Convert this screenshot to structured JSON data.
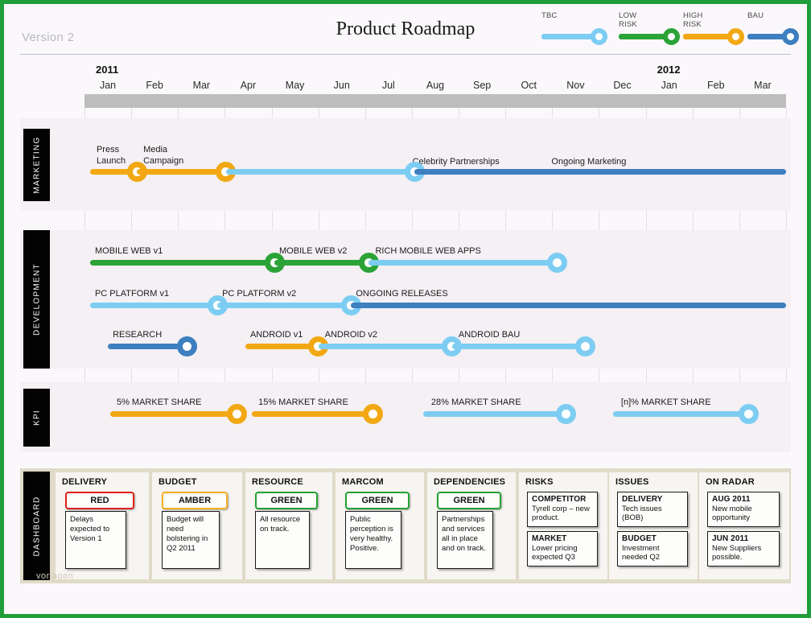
{
  "header": {
    "version": "Version 2",
    "title": "Product Roadmap"
  },
  "colors": {
    "tbc": "#7dcdf3",
    "low_risk": "#2ba337",
    "high_risk": "#f2a813",
    "bau": "#3d7fbf",
    "frame": "#1f9e3a",
    "grey_bar": "#bdbdbd",
    "band": "#f4f0f4",
    "dashboard_bg": "#dfdbc8",
    "red": "#e0201b",
    "amber": "#f2b01e",
    "green": "#23a233"
  },
  "legend": {
    "items": [
      {
        "label": "TBC",
        "color_key": "tbc"
      },
      {
        "label": "LOW\nRISK",
        "color_key": "low_risk"
      },
      {
        "label": "HIGH\nRISK",
        "color_key": "high_risk"
      },
      {
        "label": "BAU",
        "color_key": "bau"
      }
    ]
  },
  "timeline": {
    "years": [
      {
        "label": "2011",
        "month_index": 0
      },
      {
        "label": "2012",
        "month_index": 12
      }
    ],
    "months": [
      "Jan",
      "Feb",
      "Mar",
      "Apr",
      "May",
      "Jun",
      "Jul",
      "Aug",
      "Sep",
      "Oct",
      "Nov",
      "Dec",
      "Jan",
      "Feb",
      "Mar"
    ]
  },
  "sections": [
    {
      "name": "MARKETING",
      "tracks": [
        {
          "label": "Press\nLaunch",
          "color_key": "high_risk"
        },
        {
          "label": "Media\nCampaign",
          "color_key": "high_risk"
        },
        {
          "label": "Celebrity Partnerships",
          "color_key": "tbc"
        },
        {
          "label": "Ongoing Marketing",
          "color_key": "bau"
        }
      ]
    },
    {
      "name": "DEVELOPMENT",
      "tracks": [
        {
          "label": "MOBILE WEB v1",
          "color_key": "low_risk"
        },
        {
          "label": "MOBILE WEB v2",
          "color_key": "low_risk"
        },
        {
          "label": "RICH MOBILE  WEB APPS",
          "color_key": "tbc"
        },
        {
          "label": "PC PLATFORM  v1",
          "color_key": "tbc"
        },
        {
          "label": "PC PLATFORM  v2",
          "color_key": "tbc"
        },
        {
          "label": "ONGOING RELEASES",
          "color_key": "bau"
        },
        {
          "label": "RESEARCH",
          "color_key": "bau"
        },
        {
          "label": "ANDROID v1",
          "color_key": "high_risk"
        },
        {
          "label": "ANDROID v2",
          "color_key": "tbc"
        },
        {
          "label": "ANDROID BAU",
          "color_key": "tbc"
        }
      ]
    },
    {
      "name": "KPI",
      "tracks": [
        {
          "label": "5% MARKET  SHARE",
          "color_key": "high_risk"
        },
        {
          "label": "15% MARKET  SHARE",
          "color_key": "high_risk"
        },
        {
          "label": "28% MARKET  SHARE",
          "color_key": "tbc"
        },
        {
          "label": "[n]% MARKET  SHARE",
          "color_key": "tbc"
        }
      ]
    }
  ],
  "dashboard": {
    "name": "DASHBOARD",
    "status_columns": [
      {
        "heading": "DELIVERY",
        "rag": "RED",
        "rag_color_key": "red",
        "note": "Delays expected to Version 1"
      },
      {
        "heading": "BUDGET",
        "rag": "AMBER",
        "rag_color_key": "amber",
        "note": "Budget will need bolstering in Q2 2011"
      },
      {
        "heading": "RESOURCE",
        "rag": "GREEN",
        "rag_color_key": "green",
        "note": "All resource on track."
      },
      {
        "heading": "MARCOM",
        "rag": "GREEN",
        "rag_color_key": "green",
        "note": "Public perception is very healthy. Positive."
      },
      {
        "heading": "DEPENDENCIES",
        "rag": "GREEN",
        "rag_color_key": "green",
        "note": "Partnerships and services all in place and on track."
      }
    ],
    "list_columns": [
      {
        "heading": "RISKS",
        "items": [
          {
            "title": "COMPETITOR",
            "text": "Tyrell corp – new product."
          },
          {
            "title": "MARKET",
            "text": "Lower pricing expected Q3"
          }
        ]
      },
      {
        "heading": "ISSUES",
        "items": [
          {
            "title": "DELIVERY",
            "text": "Tech issues (BOB)"
          },
          {
            "title": "BUDGET",
            "text": "Investment needed Q2"
          }
        ]
      },
      {
        "heading": "ON RADAR",
        "items": [
          {
            "title": "AUG 2011",
            "text": "New mobile opportunity"
          },
          {
            "title": "JUN 2011",
            "text": "New Suppliers possible."
          }
        ]
      }
    ]
  },
  "watermark": "vorlagen"
}
